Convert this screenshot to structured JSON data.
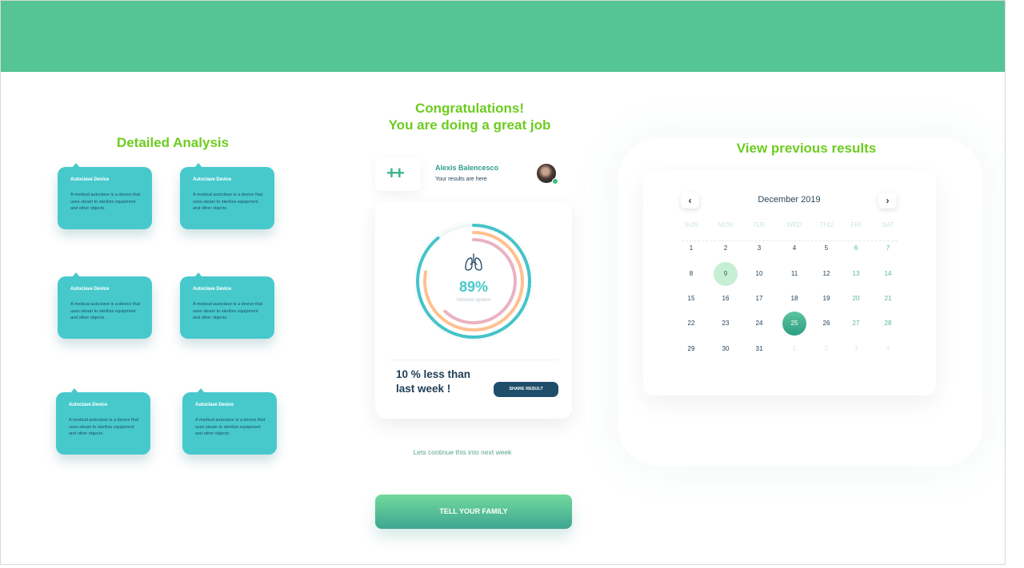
{
  "left": {
    "title": "Detailed Analysis",
    "cards": [
      {
        "title": "Autoclave Device",
        "desc": "A medical autoclave is a device that uses steam to sterilize equipment and other objects."
      },
      {
        "title": "Autoclave Device",
        "desc": "A medical autoclave is a device that uses steam to sterilize equipment and other objects."
      },
      {
        "title": "Autoclave Device",
        "desc": "A medical autoclave is a device that uses steam to sterilize equipment and other objects."
      },
      {
        "title": "Autoclave Device",
        "desc": "A medical autoclave is a device that uses steam to sterilize equipment and other objects."
      },
      {
        "title": "Autoclave Device",
        "desc": "A medical autoclave is a device that uses steam to sterilize equipment and other objects."
      },
      {
        "title": "Autoclave Device",
        "desc": "A medical autoclave is a device that uses steam to sterilize equipment and other objects."
      }
    ]
  },
  "center": {
    "congrats_line1": "Congratulations!",
    "congrats_line2": "You are doing a great job",
    "user_name": "Alexis Balencesco",
    "user_sub": "Your results are here",
    "mini_icon": "++",
    "percent": "89%",
    "percent_label": "Immune system",
    "rings": {
      "outer": 0.89,
      "middle": 0.78,
      "inner": 0.62
    },
    "less_text": "10 % less than last week !",
    "share_label": "SHARE RESULT",
    "continue_text": "Lets continue this into next week",
    "family_label": "TELL YOUR FAMILY"
  },
  "right": {
    "title": "View previous results",
    "month": "December 2019",
    "prev_icon": "‹",
    "next_icon": "›",
    "weekdays": [
      "SUN",
      "MON",
      "TUE",
      "WED",
      "THU",
      "FRI",
      "SAT"
    ],
    "weeks": [
      [
        "1",
        "2",
        "3",
        "4",
        "5",
        "6",
        "7"
      ],
      [
        "8",
        "9",
        "10",
        "11",
        "12",
        "13",
        "14"
      ],
      [
        "15",
        "16",
        "17",
        "18",
        "19",
        "20",
        "21"
      ],
      [
        "22",
        "23",
        "24",
        "25",
        "26",
        "27",
        "28"
      ],
      [
        "29",
        "30",
        "31",
        "1",
        "2",
        "3",
        "4"
      ]
    ],
    "highlight_light": "9",
    "highlight_selected": "25"
  }
}
